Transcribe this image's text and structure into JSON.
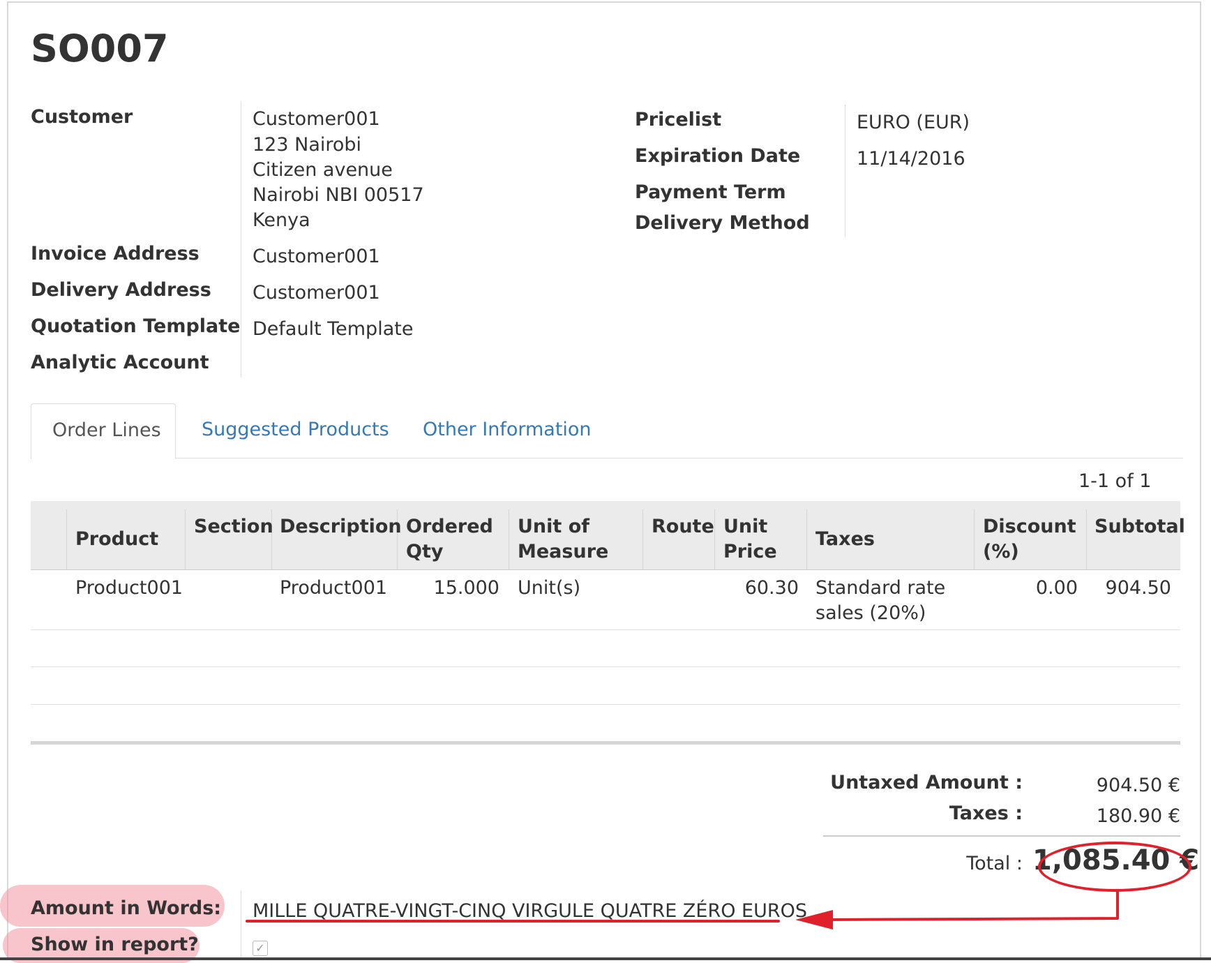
{
  "record": {
    "title": "SO007"
  },
  "left_fields": {
    "customer_label": "Customer",
    "customer_name": "Customer001",
    "address": [
      "123 Nairobi",
      "Citizen avenue",
      "Nairobi NBI 00517",
      "Kenya"
    ],
    "invoice_address_label": "Invoice Address",
    "invoice_address_value": "Customer001",
    "delivery_address_label": "Delivery Address",
    "delivery_address_value": "Customer001",
    "quotation_template_label": "Quotation Template",
    "quotation_template_value": "Default Template",
    "analytic_account_label": "Analytic Account"
  },
  "right_fields": {
    "pricelist_label": "Pricelist",
    "pricelist_value": "EURO (EUR)",
    "expiration_label": "Expiration Date",
    "expiration_value": "11/14/2016",
    "payment_term_label": "Payment Term",
    "delivery_method_label": "Delivery Method"
  },
  "tabs": [
    {
      "label": "Order Lines",
      "active": true
    },
    {
      "label": "Suggested Products",
      "active": false
    },
    {
      "label": "Other Information",
      "active": false
    }
  ],
  "pager": "1-1 of 1",
  "table": {
    "headers": {
      "product": "Product",
      "section": "Section",
      "description": "Description",
      "ordered_qty": [
        "Ordered",
        "Qty"
      ],
      "uom": [
        "Unit of",
        "Measure"
      ],
      "route": "Route",
      "unit_price": [
        "Unit",
        "Price"
      ],
      "taxes": "Taxes",
      "discount": [
        "Discount",
        "(%)"
      ],
      "subtotal": "Subtotal"
    },
    "rows": [
      {
        "product": "Product001",
        "description": "Product001",
        "ordered_qty": "15.000",
        "uom": "Unit(s)",
        "unit_price": "60.30",
        "taxes": [
          "Standard rate",
          "sales (20%)"
        ],
        "discount": "0.00",
        "subtotal": "904.50"
      }
    ]
  },
  "totals": {
    "untaxed_label": "Untaxed Amount :",
    "untaxed_value": "904.50 €",
    "taxes_label": "Taxes :",
    "taxes_value": "180.90 €",
    "total_label": "Total :",
    "total_value": "1,085.40 €"
  },
  "amount_words": {
    "label": "Amount in Words:",
    "value": "MILLE QUATRE-VINGT-CINQ VIRGULE QUATRE ZÉRO EUROS",
    "show_label": "Show in report?",
    "show_checked": true
  },
  "colors": {
    "link": "#337ab7",
    "annotation": "#e0202a",
    "highlight": "#f096a0"
  }
}
